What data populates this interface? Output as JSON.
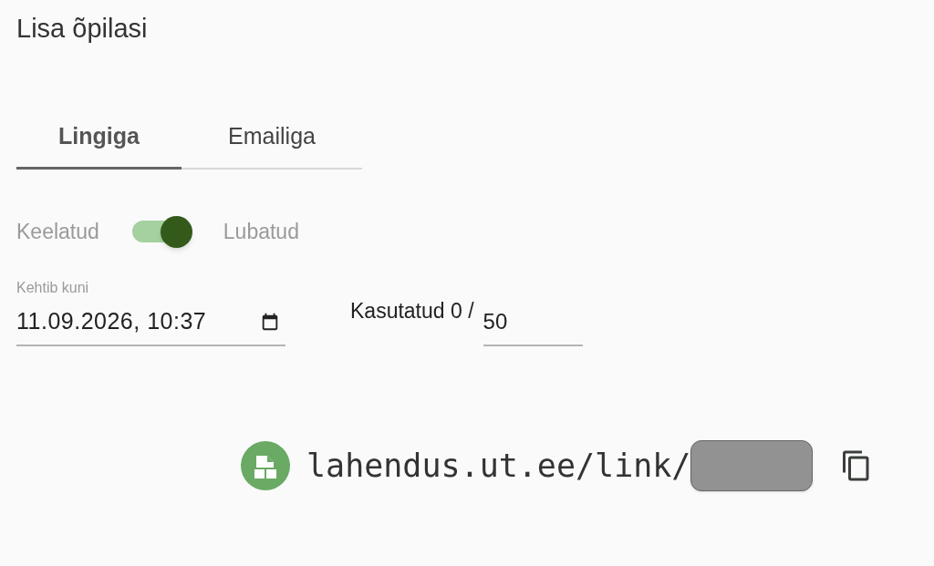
{
  "title": "Lisa õpilasi",
  "tabs": [
    {
      "label": "Lingiga",
      "selected": true
    },
    {
      "label": "Emailiga",
      "selected": false
    }
  ],
  "toggle": {
    "off_label": "Keelatud",
    "on_label": "Lubatud",
    "on": true
  },
  "expiry": {
    "label": "Kehtib kuni",
    "value": "11.09.2026, 10:37"
  },
  "usage": {
    "label": "Kasutatud 0 /",
    "max": "50"
  },
  "link": {
    "text": "lahendus.ut.ee/link/"
  }
}
